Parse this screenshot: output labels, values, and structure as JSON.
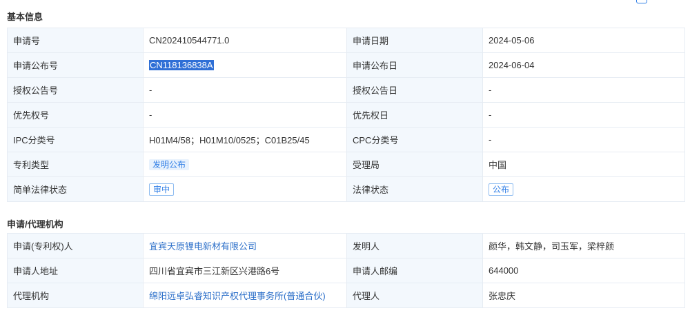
{
  "basic": {
    "title": "基本信息",
    "rows": [
      {
        "l1": "申请号",
        "v1": "CN202410544771.0",
        "l2": "申请日期",
        "v2": "2024-05-06"
      },
      {
        "l1": "申请公布号",
        "v1": "CN118136838A",
        "l2": "申请公布日",
        "v2": "2024-06-04"
      },
      {
        "l1": "授权公告号",
        "v1": "-",
        "l2": "授权公告日",
        "v2": "-"
      },
      {
        "l1": "优先权号",
        "v1": "-",
        "l2": "优先权日",
        "v2": "-"
      },
      {
        "l1": "IPC分类号",
        "v1": "H01M4/58；H01M10/0525；C01B25/45",
        "l2": "CPC分类号",
        "v2": "-"
      },
      {
        "l1": "专利类型",
        "v1": "发明公布",
        "l2": "受理局",
        "v2": "中国"
      },
      {
        "l1": "简单法律状态",
        "v1": "审中",
        "l2": "法律状态",
        "v2": "公布"
      }
    ]
  },
  "applicant": {
    "title": "申请/代理机构",
    "rows": [
      {
        "l1": "申请(专利权)人",
        "v1": "宜宾天原锂电新材有限公司",
        "l2": "发明人",
        "v2": "颜华，韩文静，司玉军，梁梓颜"
      },
      {
        "l1": "申请人地址",
        "v1": "四川省宜宾市三江新区兴港路6号",
        "l2": "申请人邮编",
        "v2": "644000"
      },
      {
        "l1": "代理机构",
        "v1": "绵阳远卓弘睿知识产权代理事务所(普通合伙)",
        "l2": "代理人",
        "v2": "张忠庆"
      }
    ]
  },
  "colors": {
    "label_bg": "#f3f8fd",
    "border": "#e6ecf3",
    "link": "#2c6fc9",
    "accent": "#2f7ee6",
    "highlight": "#2f6fd6"
  }
}
